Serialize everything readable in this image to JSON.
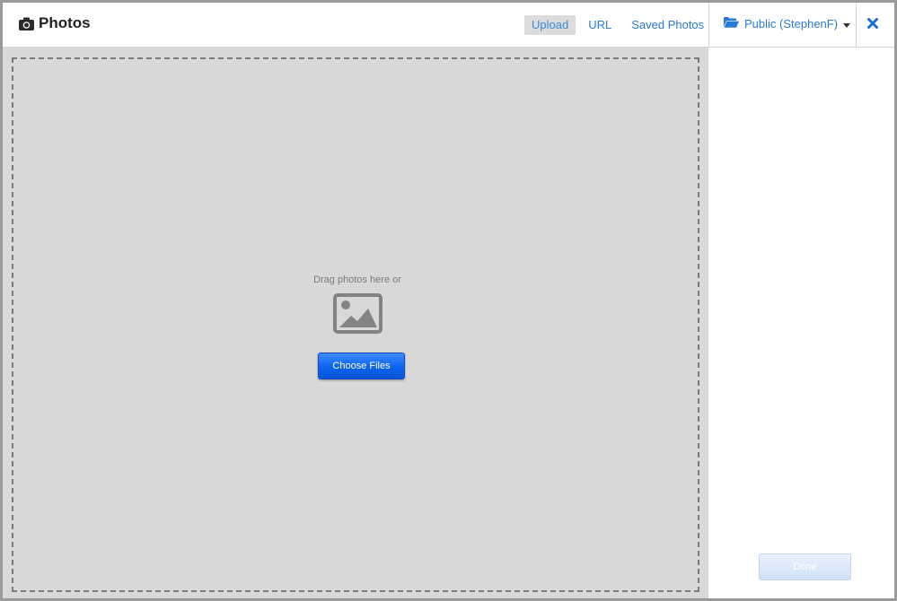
{
  "header": {
    "title": "Photos",
    "tabs": [
      {
        "label": "Upload",
        "active": true
      },
      {
        "label": "URL",
        "active": false
      },
      {
        "label": "Saved Photos",
        "active": false
      }
    ],
    "album_label": "Public (StephenF)"
  },
  "upload": {
    "drag_text": "Drag photos here or",
    "choose_label": "Choose Files"
  },
  "sidebar": {
    "done_label": "Done",
    "done_enabled": false
  },
  "icons": {
    "title": "camera-icon",
    "album": "folder-open-icon",
    "album_caret": "caret-down-icon",
    "close": "close-icon",
    "placeholder": "image-icon"
  },
  "colors": {
    "accent": "#2a7ad6",
    "primary_button": "#0b63ee",
    "upload_bg": "#d8d8d8"
  }
}
